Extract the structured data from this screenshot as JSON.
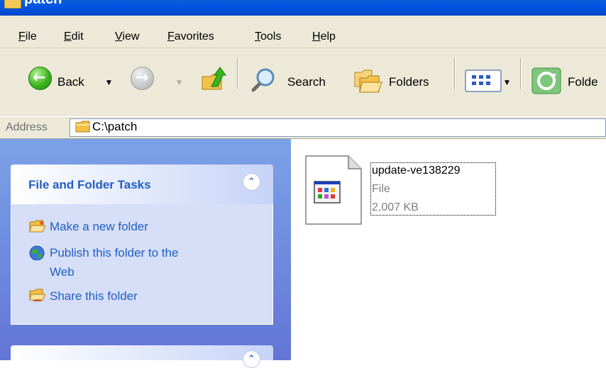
{
  "window": {
    "title": "patch"
  },
  "menu": [
    "File",
    "Edit",
    "View",
    "Favorites",
    "Tools",
    "Help"
  ],
  "toolbar": {
    "back_label": "Back",
    "search_label": "Search",
    "folders_label": "Folders",
    "folder_sync_label": "Folde"
  },
  "address": {
    "label": "Address",
    "value": "C:\\patch"
  },
  "tasks": {
    "title": "File and Folder Tasks",
    "items": [
      "Make a new folder",
      "Publish this folder to the",
      "Web",
      "Share this folder"
    ]
  },
  "file": {
    "name": "update-ve138229",
    "type": "File",
    "size": "2,007 KB"
  },
  "colors": {
    "title_bar": "#0055e5",
    "task_pane": "#7ba2e7",
    "task_link": "#215dc6"
  }
}
